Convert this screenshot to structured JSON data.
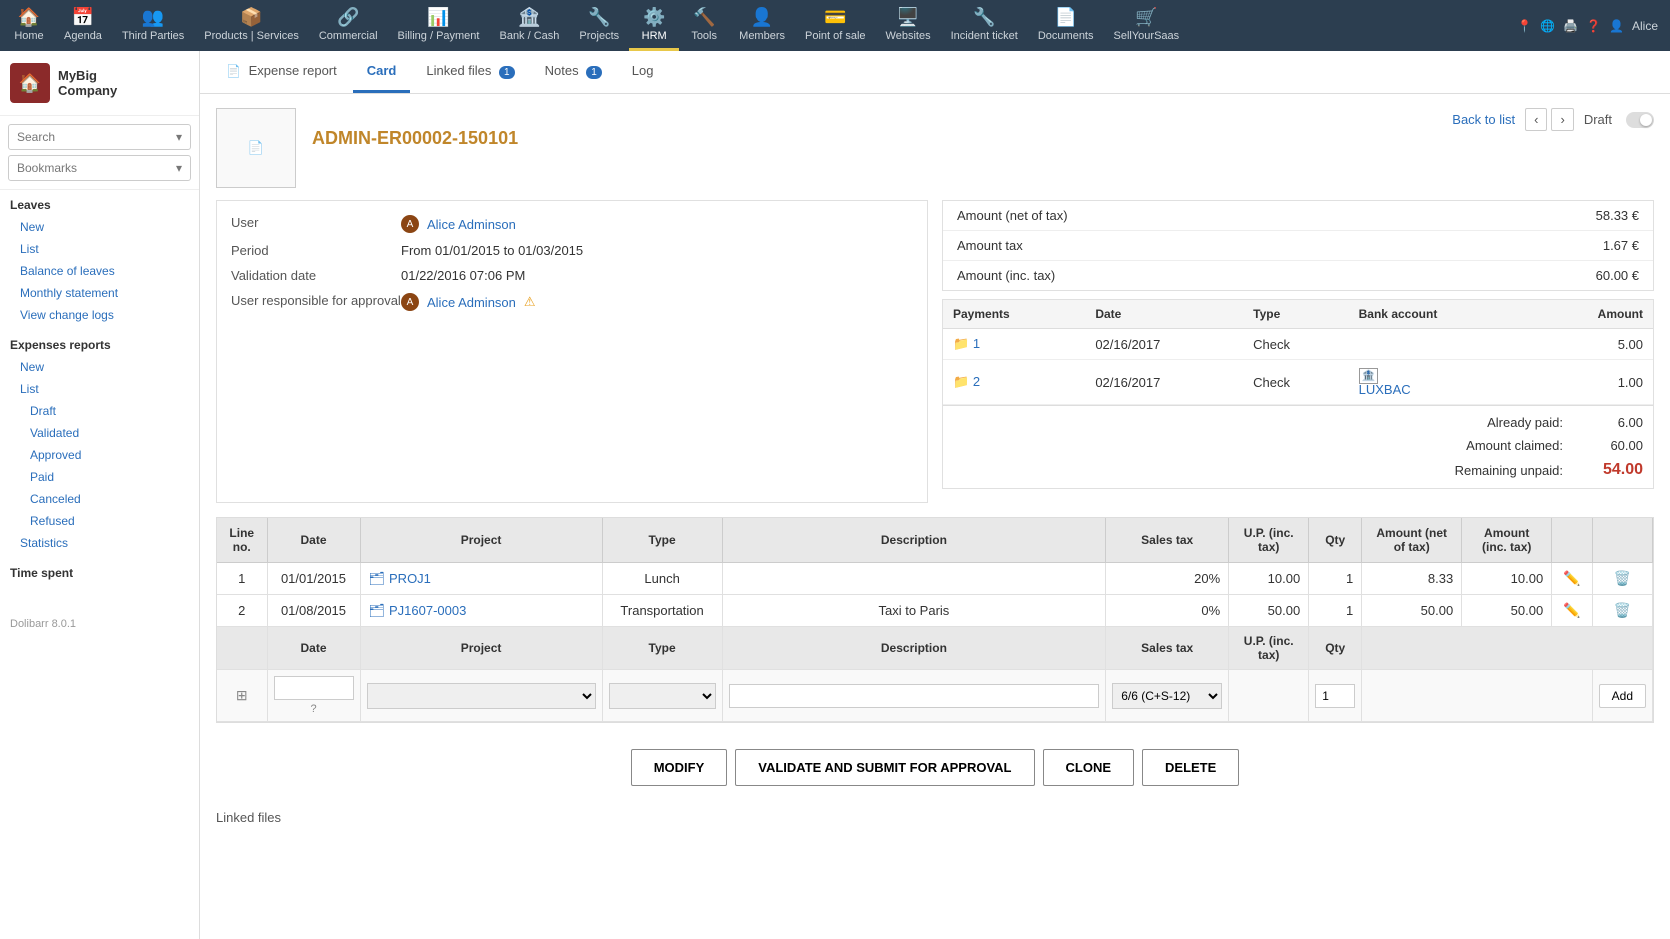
{
  "nav": {
    "items": [
      {
        "id": "home",
        "label": "Home",
        "icon": "🏠"
      },
      {
        "id": "agenda",
        "label": "Agenda",
        "icon": "📅"
      },
      {
        "id": "third-parties",
        "label": "Third Parties",
        "icon": "👥"
      },
      {
        "id": "products",
        "label": "Products | Services",
        "icon": "📦"
      },
      {
        "id": "commercial",
        "label": "Commercial",
        "icon": "🔗"
      },
      {
        "id": "billing",
        "label": "Billing / Payment",
        "icon": "📊"
      },
      {
        "id": "bank",
        "label": "Bank / Cash",
        "icon": "🏦"
      },
      {
        "id": "projects",
        "label": "Projects",
        "icon": "🔧"
      },
      {
        "id": "hrm",
        "label": "HRM",
        "icon": "⚙️",
        "active": true
      },
      {
        "id": "tools",
        "label": "Tools",
        "icon": "🔨"
      },
      {
        "id": "members",
        "label": "Members",
        "icon": "👤"
      },
      {
        "id": "pos",
        "label": "Point of sale",
        "icon": "💳"
      },
      {
        "id": "websites",
        "label": "Websites",
        "icon": "🖥️"
      },
      {
        "id": "incident",
        "label": "Incident ticket",
        "icon": "🔧"
      },
      {
        "id": "documents",
        "label": "Documents",
        "icon": "📄"
      },
      {
        "id": "sellyoursaas",
        "label": "SellYourSaas",
        "icon": "🛒"
      }
    ],
    "right_items": [
      "🌐",
      "🖨️",
      "❓",
      "👤"
    ],
    "user": "Alice"
  },
  "sidebar": {
    "logo_text_line1": "MyBig",
    "logo_text_line2": "Company",
    "search_placeholder": "Search",
    "bookmarks_placeholder": "Bookmarks",
    "sections": [
      {
        "title": "Leaves",
        "items": [
          {
            "label": "New",
            "indent": false
          },
          {
            "label": "List",
            "indent": false
          },
          {
            "label": "Balance of leaves",
            "indent": false
          },
          {
            "label": "Monthly statement",
            "indent": false
          },
          {
            "label": "View change logs",
            "indent": false
          }
        ]
      },
      {
        "title": "Expenses reports",
        "items": [
          {
            "label": "New",
            "indent": false
          },
          {
            "label": "List",
            "indent": false
          },
          {
            "label": "Draft",
            "indent": true
          },
          {
            "label": "Validated",
            "indent": true
          },
          {
            "label": "Approved",
            "indent": true
          },
          {
            "label": "Paid",
            "indent": true
          },
          {
            "label": "Canceled",
            "indent": true
          },
          {
            "label": "Refused",
            "indent": true
          },
          {
            "label": "Statistics",
            "indent": false
          }
        ]
      },
      {
        "title": "Time spent",
        "items": []
      }
    ],
    "footer": "Dolibarr 8.0.1"
  },
  "tabs": [
    {
      "label": "Expense report",
      "id": "expense-report",
      "active": false,
      "badge": null,
      "icon": "📄"
    },
    {
      "label": "Card",
      "id": "card",
      "active": true,
      "badge": null,
      "icon": null
    },
    {
      "label": "Linked files",
      "id": "linked-files",
      "active": false,
      "badge": "1",
      "icon": null
    },
    {
      "label": "Notes",
      "id": "notes",
      "active": false,
      "badge": "1",
      "icon": null
    },
    {
      "label": "Log",
      "id": "log",
      "active": false,
      "badge": null,
      "icon": null
    }
  ],
  "document": {
    "id": "ADMIN-ER00002-150101",
    "status": "Draft",
    "back_to_list": "Back to list"
  },
  "info": {
    "user_label": "User",
    "user_name": "Alice Adminson",
    "period_label": "Period",
    "period_value": "From 01/01/2015 to 01/03/2015",
    "validation_label": "Validation date",
    "validation_value": "01/22/2016 07:06 PM",
    "responsible_label": "User responsible for approval",
    "responsible_name": "Alice Adminson"
  },
  "amounts": {
    "net_of_tax_label": "Amount (net of tax)",
    "net_of_tax_value": "58.33 €",
    "tax_label": "Amount tax",
    "tax_value": "1.67 €",
    "inc_tax_label": "Amount (inc. tax)",
    "inc_tax_value": "60.00 €"
  },
  "payments": {
    "columns": [
      "Payments",
      "Date",
      "Type",
      "Bank account",
      "Amount"
    ],
    "rows": [
      {
        "id": "1",
        "date": "02/16/2017",
        "type": "Check",
        "bank": "",
        "amount": "5.00"
      },
      {
        "id": "2",
        "date": "02/16/2017",
        "type": "Check",
        "bank": "LUXBAC",
        "amount": "1.00"
      }
    ],
    "already_paid_label": "Already paid:",
    "already_paid_value": "6.00",
    "amount_claimed_label": "Amount claimed:",
    "amount_claimed_value": "60.00",
    "remaining_label": "Remaining unpaid:",
    "remaining_value": "54.00"
  },
  "lines": {
    "columns": [
      "Line no.",
      "Date",
      "Project",
      "Type",
      "Description",
      "Sales tax",
      "U.P. (inc. tax)",
      "Qty",
      "Amount (net of tax)",
      "Amount (inc. tax)",
      "",
      ""
    ],
    "rows": [
      {
        "line": "1",
        "date": "01/01/2015",
        "project": "PROJ1",
        "type": "Lunch",
        "description": "",
        "tax": "20%",
        "up": "10.00",
        "qty": "1",
        "net": "8.33",
        "inc": "10.00"
      },
      {
        "line": "2",
        "date": "01/08/2015",
        "project": "PJ1607-0003",
        "type": "Transportation",
        "description": "Taxi to Paris",
        "tax": "0%",
        "up": "50.00",
        "qty": "1",
        "net": "50.00",
        "inc": "50.00"
      }
    ],
    "add_row": {
      "tax_default": "6/6 (C+S-12)",
      "qty_default": "1",
      "add_button": "Add"
    }
  },
  "buttons": {
    "modify": "MODIFY",
    "validate": "VALIDATE AND SUBMIT FOR APPROVAL",
    "clone": "CLONE",
    "delete": "DELETE"
  },
  "linked_files_label": "Linked files"
}
